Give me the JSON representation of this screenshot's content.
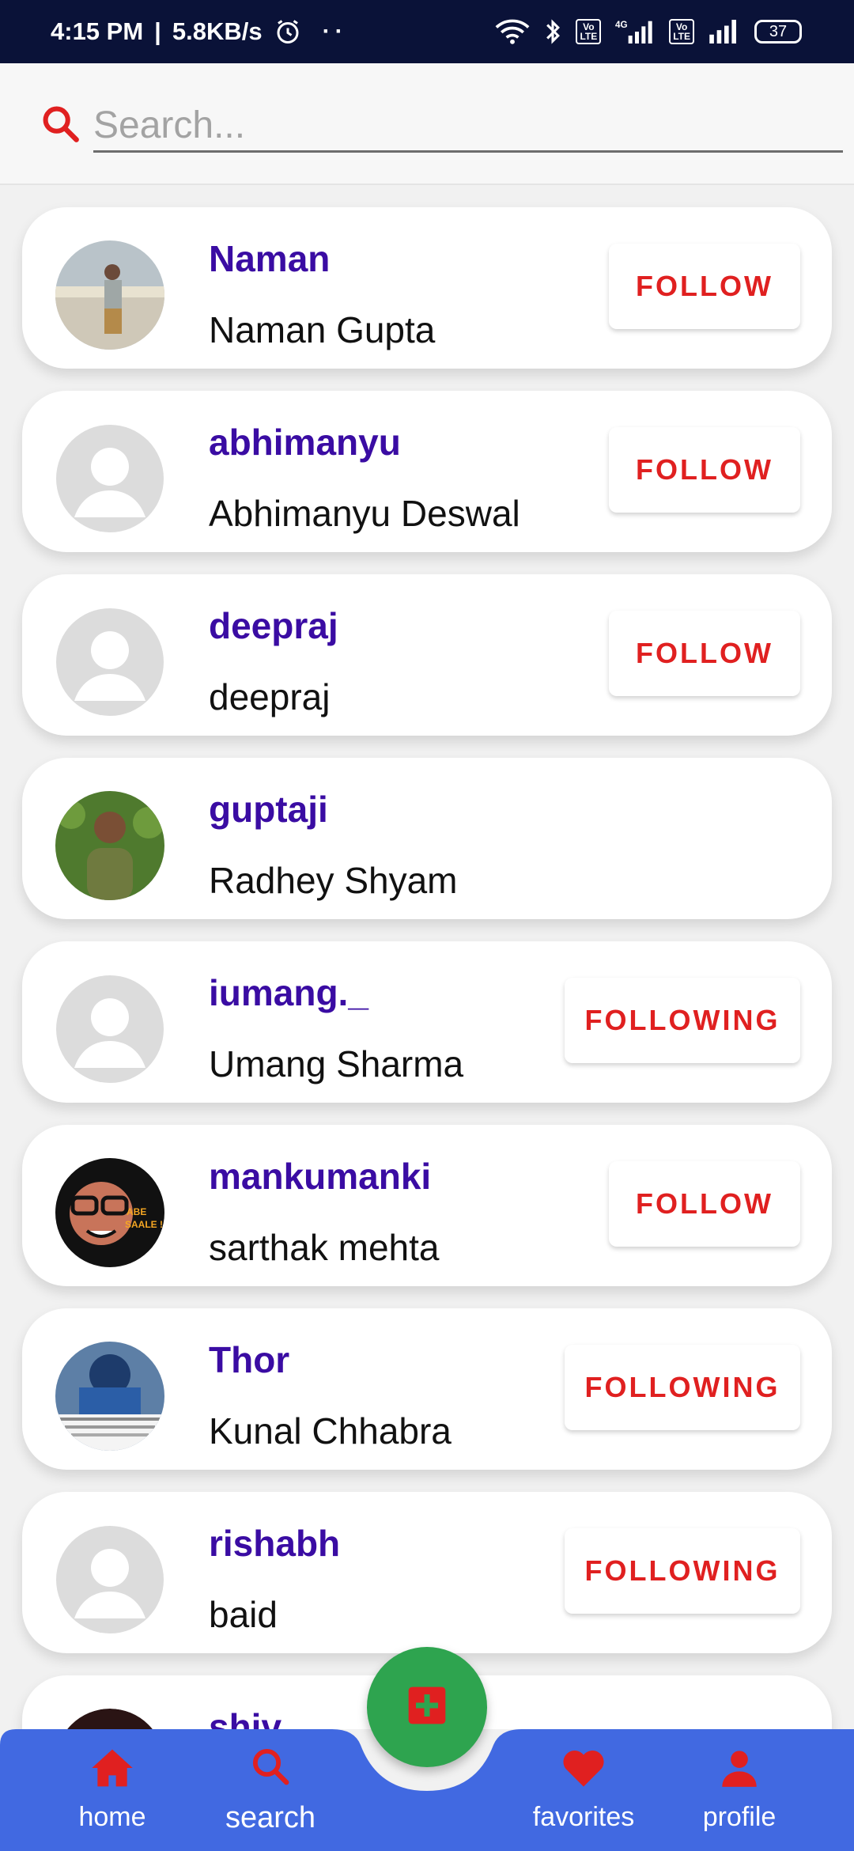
{
  "status_bar": {
    "time": "4:15 PM",
    "speed": "5.8KB/s",
    "dots": "··",
    "network_label": "4G",
    "volte_label": "Vo\nLTE",
    "battery": "37"
  },
  "search": {
    "placeholder": "Search..."
  },
  "users": [
    {
      "username": "Naman",
      "name": "Naman Gupta",
      "button": "FOLLOW",
      "avatar": "photo-outdoor"
    },
    {
      "username": "abhimanyu",
      "name": "Abhimanyu Deswal",
      "button": "FOLLOW",
      "avatar": "default"
    },
    {
      "username": "deepraj",
      "name": "deepraj",
      "button": "FOLLOW",
      "avatar": "default"
    },
    {
      "username": "guptaji",
      "name": "Radhey Shyam",
      "button": "",
      "avatar": "photo-green"
    },
    {
      "username": "iumang._",
      "name": "Umang Sharma",
      "button": "FOLLOWING",
      "avatar": "default"
    },
    {
      "username": "mankumanki",
      "name": "sarthak mehta",
      "button": "FOLLOW",
      "avatar": "cartoon"
    },
    {
      "username": "Thor",
      "name": "Kunal Chhabra",
      "button": "FOLLOWING",
      "avatar": "photo-cricket"
    },
    {
      "username": "rishabh",
      "name": "baid",
      "button": "FOLLOWING",
      "avatar": "default"
    },
    {
      "username": "shiv",
      "name": "",
      "button": "",
      "avatar": "photo-dark"
    }
  ],
  "avatar_overlay_text": {
    "cartoon": "ABE SAALE !"
  },
  "nav": {
    "home": "home",
    "search": "search",
    "favorites": "favorites",
    "profile": "profile"
  },
  "colors": {
    "username": "#3a0ca3",
    "accent_red": "#e02020",
    "nav_blue": "#4169e1",
    "fab_green": "#2ea44f",
    "status_bar": "#0a1238"
  }
}
